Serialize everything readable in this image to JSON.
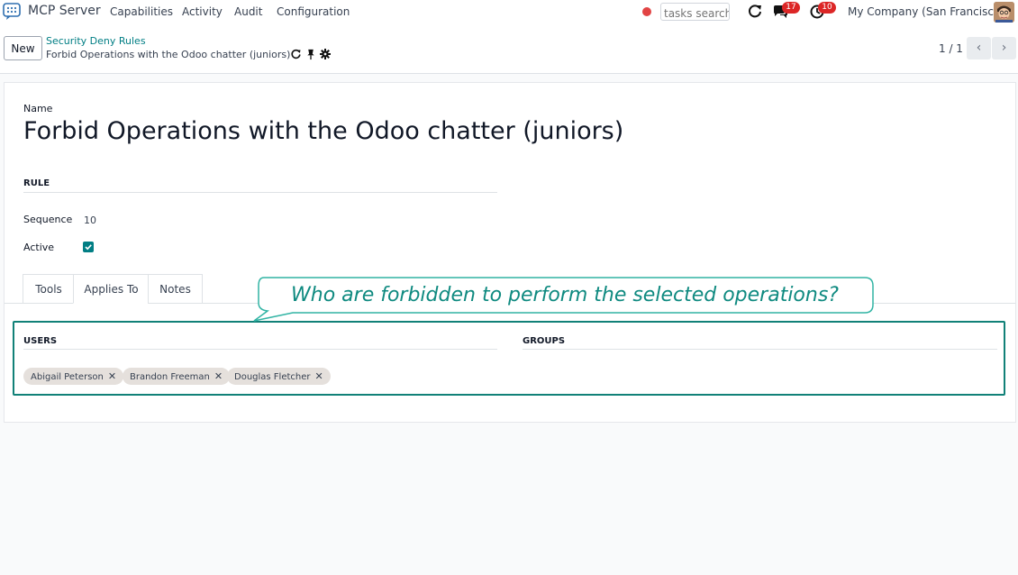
{
  "navbar": {
    "app_name": "MCP Server",
    "menu": [
      "Capabilities",
      "Activity",
      "Audit",
      "Configuration"
    ],
    "search_placeholder": "tasks search",
    "messages_count": "17",
    "activities_count": "10",
    "company": "My Company (San Francisco)"
  },
  "control": {
    "new_label": "New",
    "breadcrumb_parent": "Security Deny Rules",
    "breadcrumb_current": "Forbid Operations with the Odoo chatter (juniors)",
    "pager": "1 / 1"
  },
  "form": {
    "name_label": "Name",
    "name_value": "Forbid Operations with the Odoo chatter (juniors)",
    "rule_section": "RULE",
    "sequence_label": "Sequence",
    "sequence_value": "10",
    "active_label": "Active",
    "active_checked": true,
    "tabs": [
      "Tools",
      "Applies To",
      "Notes"
    ],
    "active_tab": "Applies To",
    "users_section": "USERS",
    "groups_section": "GROUPS",
    "users": [
      "Abigail Peterson",
      "Brandon Freeman",
      "Douglas Fletcher"
    ]
  },
  "callout": {
    "text": "Who are forbidden to perform the selected operations?"
  },
  "colors": {
    "accent": "#017e84",
    "highlight": "#118178",
    "badge": "#dc2626",
    "recording_dot": "#e24444"
  }
}
